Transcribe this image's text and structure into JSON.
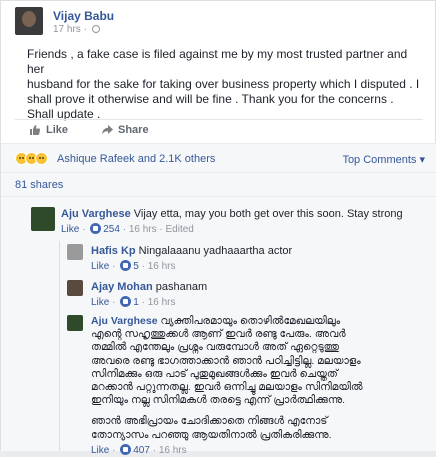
{
  "post": {
    "author": "Vijay Babu",
    "time": "17 hrs ·",
    "text_lines": [
      "Friends , a fake case is filed against me by my most trusted partner and her",
      "husband for the sake for taking over business property which I disputed . I",
      "shall prove it otherwise and will be fine . Thank you for the concerns .",
      "Shall update ."
    ]
  },
  "actions": {
    "like_label": "Like",
    "share_label": "Share"
  },
  "reactions": {
    "summary": "Ashique Rafeek and 2.1K others",
    "top_comments_label": "Top Comments ▾"
  },
  "shares": {
    "label": "81 shares"
  },
  "comments": [
    {
      "author": "Aju Varghese",
      "text": " Vijay etta, may you both get over this soon. Stay strong",
      "meta_like": "Like",
      "meta_count": "254",
      "meta_rest": " · 16 hrs · Edited"
    }
  ],
  "replies": [
    {
      "author": "Hafis Kp",
      "text": " Ningalaaanu yadhaaartha actor",
      "meta_like": "Like",
      "meta_count": "5",
      "meta_rest": " · 16 hrs"
    },
    {
      "author": "Ajay Mohan",
      "text": " pashanam",
      "meta_like": "Like",
      "meta_count": "1",
      "meta_rest": " · 16 hrs"
    },
    {
      "author": "Aju Varghese",
      "text_lines": [
        " വ്യക്തിപരമായും തൊഴിൽമേഖലയിലും",
        "എന്റെ സഹൃത്തുക്കൾ ആണ് ഇവർ രണ്ടു പേരും. അവർ",
        "തമ്മിൽ എന്തേലും പ്രശ്നം വരുമ്പോൾ അത് ഏറ്റെടുത്തു",
        "അവരെ രണ്ടു ഭാഗത്താക്കാൻ ഞാൻ പഠിച്ചിട്ടില്ല. മലയാളം",
        "സിനിമക്കും ഒരു പാട് പുതുമുഖങ്ങൾക്കും ഇവർ ചെയ്തത്",
        "മറക്കാൻ പറ്റുന്നതല്ല. ഇവർ ഒന്നിച്ചു മലയാളം സിനിമയിൽ",
        "ഇനിയും നല്ല സിനിമകൾ തരട്ടെ എന്ന് പ്രാർത്ഥിക്കുന്നു.",
        "",
        "ഞാൻ അഭിപ്രായം ചോദിക്കാതെ നിങ്ങൾ എനോട്",
        "തോന്യാസം പറഞ്ഞു ആയതിനാൽ പ്രതികരിക്കുന്നു."
      ],
      "meta_like": "Like",
      "meta_count": "407",
      "meta_rest": " · 16 hrs"
    }
  ]
}
